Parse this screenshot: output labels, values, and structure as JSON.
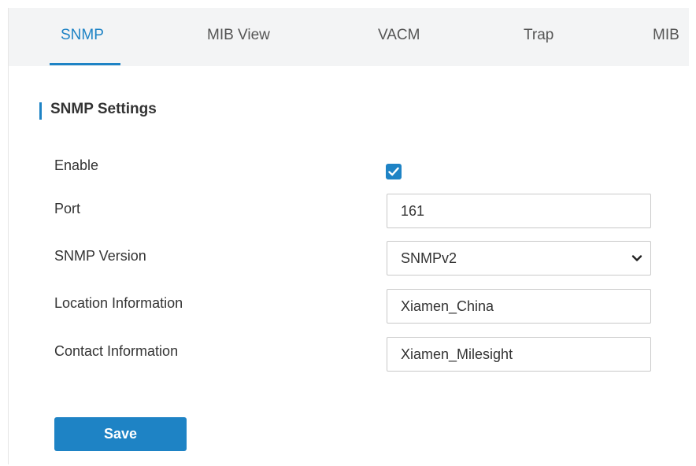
{
  "tabs": [
    {
      "label": "SNMP",
      "active": true
    },
    {
      "label": "MIB View",
      "active": false
    },
    {
      "label": "VACM",
      "active": false
    },
    {
      "label": "Trap",
      "active": false
    },
    {
      "label": "MIB",
      "active": false
    }
  ],
  "section": {
    "title": "SNMP Settings"
  },
  "form": {
    "enable": {
      "label": "Enable",
      "checked": true
    },
    "port": {
      "label": "Port",
      "value": "161"
    },
    "version": {
      "label": "SNMP Version",
      "value": "SNMPv2"
    },
    "location": {
      "label": "Location Information",
      "value": "Xiamen_China"
    },
    "contact": {
      "label": "Contact Information",
      "value": "Xiamen_Milesight"
    }
  },
  "actions": {
    "save_label": "Save"
  },
  "colors": {
    "accent": "#1e83c5",
    "tab_bg": "#f3f4f5",
    "text": "#333333"
  },
  "icons": {
    "checkbox": "checkmark-icon",
    "select": "chevron-down-icon"
  }
}
